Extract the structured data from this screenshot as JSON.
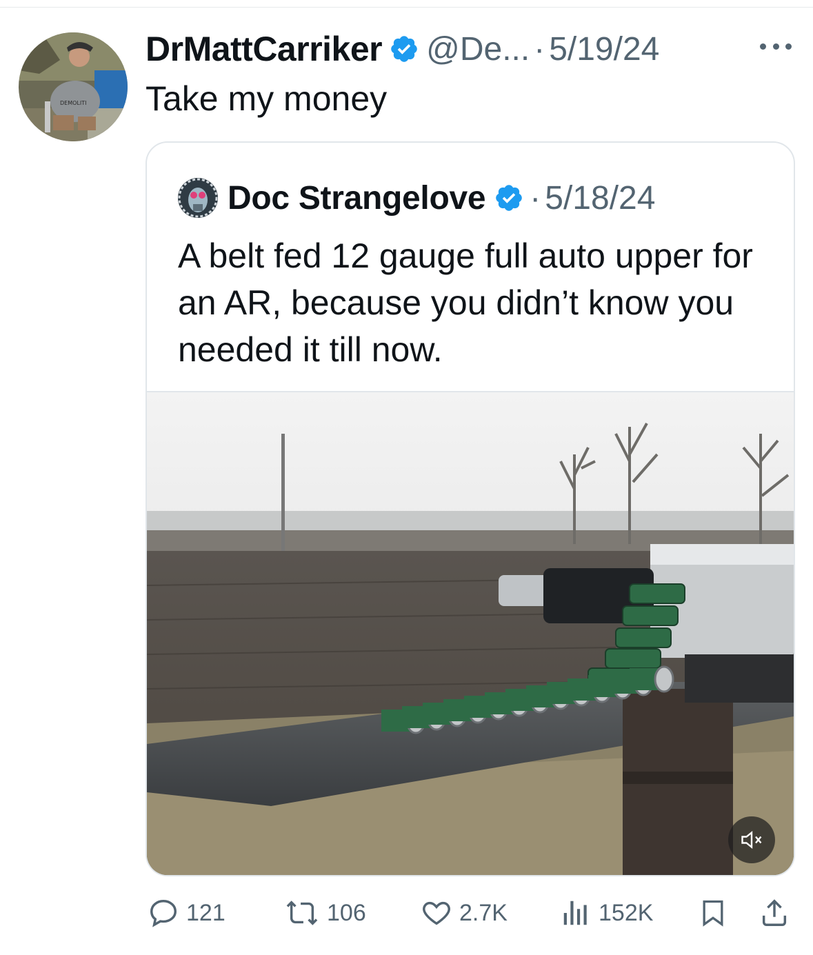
{
  "tweet": {
    "author_name": "DrMattCarriker",
    "handle": "@De...",
    "separator": "·",
    "date": "5/19/24",
    "text": "Take my money",
    "avatar_print": "DEMOLITI",
    "more_icon": "more-horizontal-icon",
    "verified_color": "#1d9bf0"
  },
  "quoted": {
    "author_name": "Doc Strangelove",
    "separator": "·",
    "date": "5/18/24",
    "text": "A belt fed 12 gauge full auto upper for an AR, because you didn’t know you needed it till now.",
    "media_type": "video",
    "mute_icon": "volume-muted-icon"
  },
  "actions": {
    "replies": "121",
    "reposts": "106",
    "likes": "2.7K",
    "views": "152K",
    "icons": [
      "reply-icon",
      "repost-icon",
      "like-icon",
      "views-icon",
      "bookmark-icon",
      "share-icon"
    ]
  },
  "colors": {
    "text": "#0f1419",
    "muted": "#536471",
    "border": "#e1e6ea",
    "accent": "#1d9bf0"
  }
}
